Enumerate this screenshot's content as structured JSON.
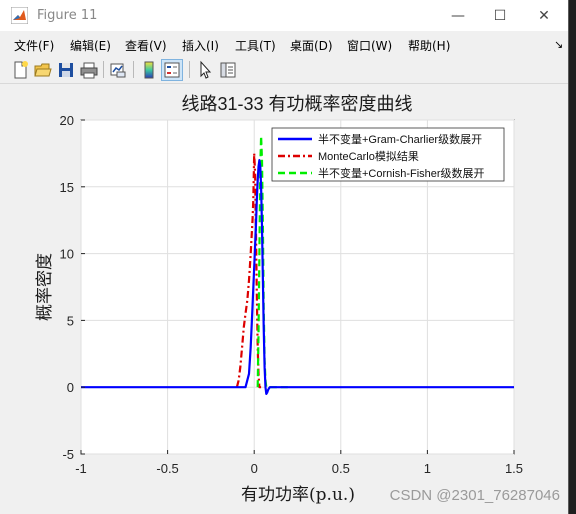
{
  "window": {
    "title": "Figure 11",
    "minimize": "—",
    "maximize": "☐",
    "close": "✕"
  },
  "menu": {
    "items": [
      "文件(F)",
      "编辑(E)",
      "查看(V)",
      "插入(I)",
      "工具(T)",
      "桌面(D)",
      "窗口(W)",
      "帮助(H)"
    ],
    "overflow_arrow": "↘"
  },
  "toolbar": {
    "icons": [
      "new-figure-icon",
      "open-folder-icon",
      "save-icon",
      "print-icon",
      "link-plot-icon",
      "colorbar-icon",
      "legend-icon",
      "edit-plot-icon",
      "property-inspector-icon"
    ]
  },
  "watermark": "CSDN @2301_76287046",
  "colors": {
    "series_blue": "#0000ff",
    "series_red": "#dd0000",
    "series_green": "#00ee00"
  },
  "chart_data": {
    "type": "line",
    "title": "线路31-33 有功概率密度曲线",
    "xlabel": "有功功率(p.u.)",
    "ylabel": "概率密度",
    "xlim": [
      -1,
      1.5
    ],
    "ylim": [
      -5,
      20
    ],
    "xticks": [
      "-1",
      "-0.5",
      "0",
      "0.5",
      "1",
      "1.5"
    ],
    "yticks": [
      "-5",
      "0",
      "5",
      "10",
      "15",
      "20"
    ],
    "grid": true,
    "legend_position": "top-right",
    "series": [
      {
        "name": "半不变量+Gram-Charlier级数展开",
        "color": "#0000ff",
        "style": "solid",
        "x": [
          -1,
          -0.05,
          -0.03,
          -0.02,
          -0.01,
          0,
          0.01,
          0.015,
          0.02,
          0.025,
          0.03,
          0.035,
          0.04,
          0.045,
          0.05,
          0.055,
          0.06,
          0.065,
          0.07,
          0.075,
          0.08,
          0.085,
          0.09,
          0.1,
          0.12,
          1.5
        ],
        "y": [
          0,
          0,
          1,
          3,
          6,
          9,
          12,
          14,
          15.5,
          16.5,
          17,
          16.5,
          15,
          12,
          8,
          4.5,
          1.5,
          0,
          -0.5,
          -0.4,
          -0.2,
          -0.1,
          0,
          0,
          0,
          0
        ]
      },
      {
        "name": "MonteCarlo模拟结果",
        "color": "#dd0000",
        "style": "dashdot",
        "x": [
          -0.1,
          -0.09,
          -0.08,
          -0.07,
          -0.06,
          -0.05,
          -0.04,
          -0.03,
          -0.02,
          -0.01,
          -0.005,
          0,
          0.005,
          0.01,
          0.015,
          0.02,
          0.025,
          0.03,
          0.04
        ],
        "y": [
          0,
          0.5,
          1.5,
          3,
          4.5,
          5.5,
          6.5,
          8,
          10,
          12.5,
          14,
          17.5,
          16,
          12,
          7,
          3,
          1,
          0,
          0
        ]
      },
      {
        "name": "半不变量+Cornish-Fisher级数展开",
        "color": "#00ee00",
        "style": "dashed",
        "x": [
          0.02,
          0.025,
          0.03,
          0.035,
          0.04,
          0.045,
          0.05,
          0.055,
          0.06,
          0.065,
          0.07,
          0.08,
          0.1,
          0.15,
          0.2
        ],
        "y": [
          0,
          4,
          10,
          16.5,
          18.8,
          17,
          12,
          6,
          2,
          0.5,
          0,
          0,
          0,
          0,
          0
        ]
      }
    ]
  }
}
